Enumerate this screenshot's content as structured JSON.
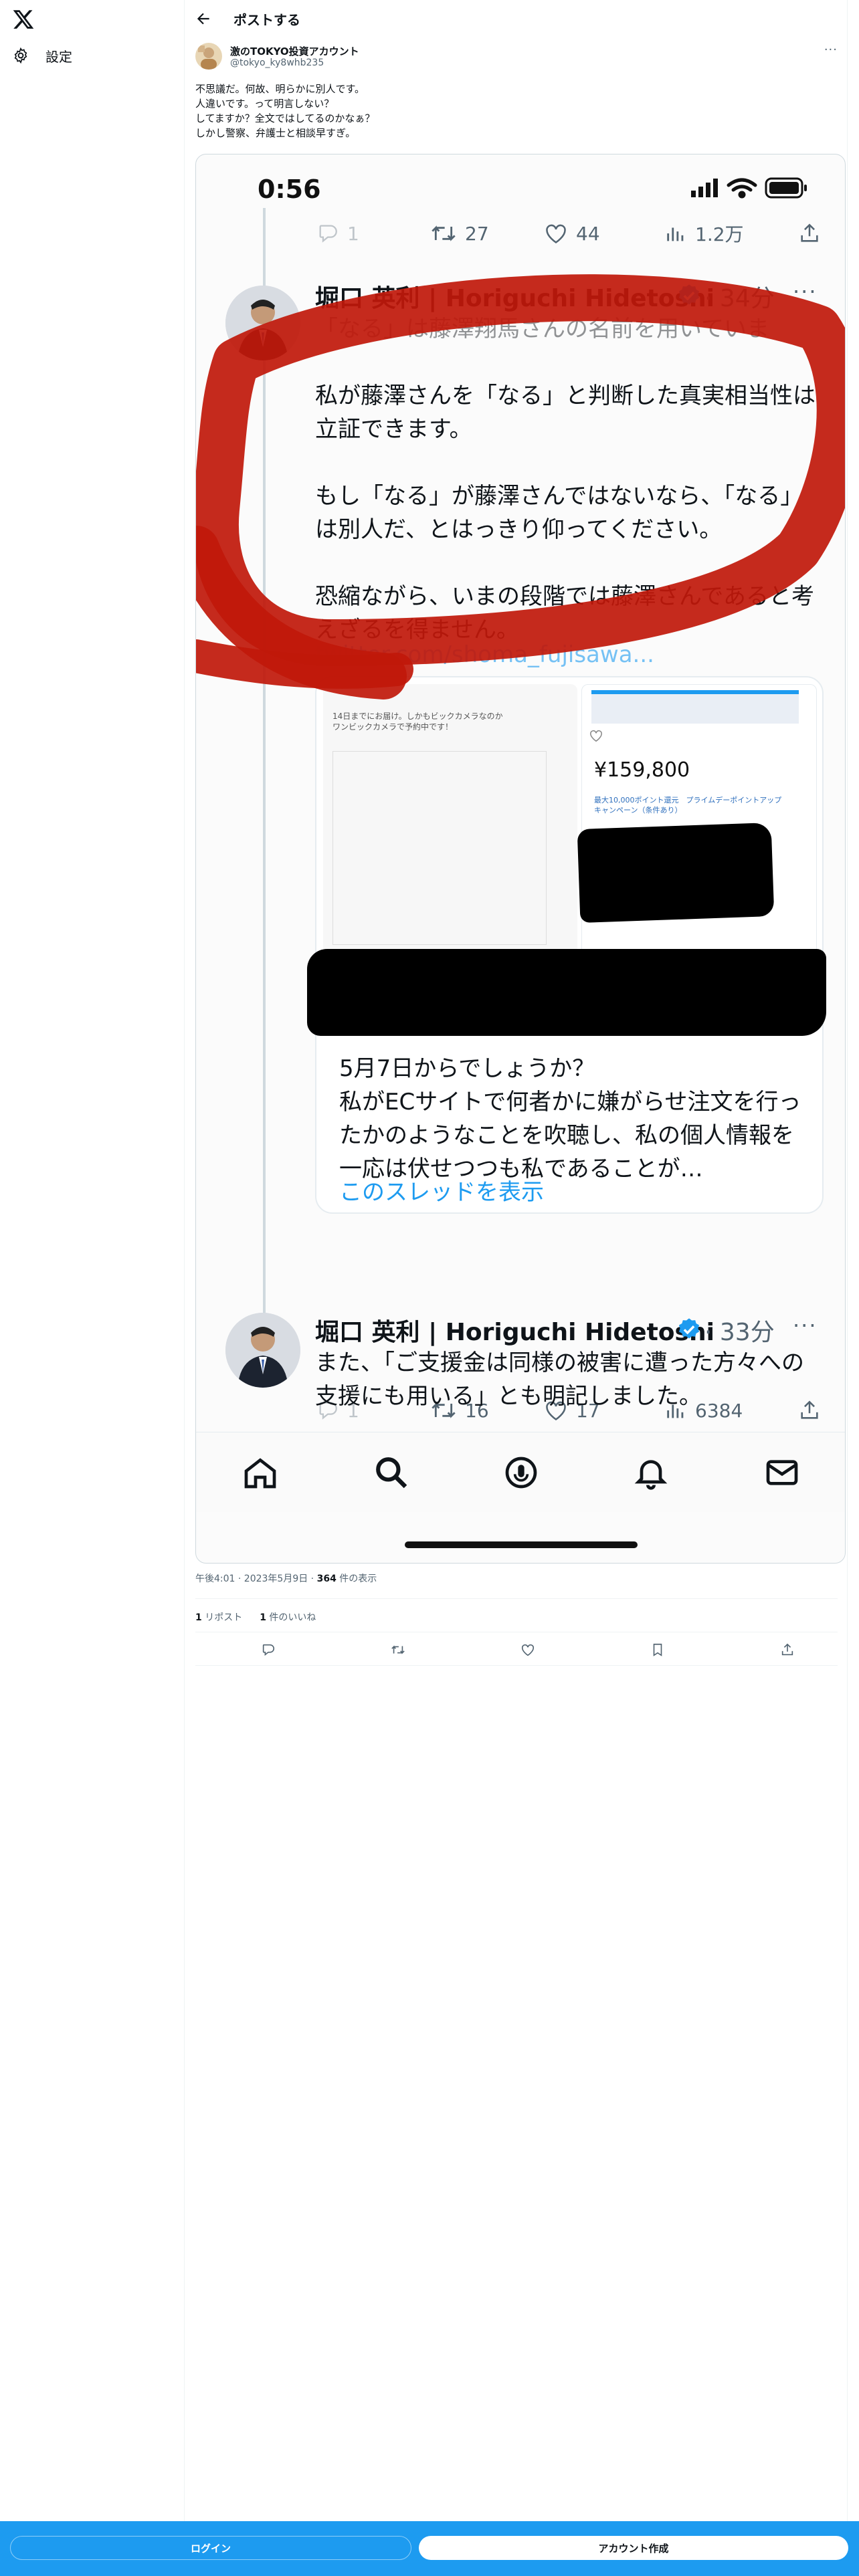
{
  "sidebar": {
    "logo_icon": "x-logo-icon",
    "settings_label": "設定"
  },
  "header": {
    "title": "ポストする"
  },
  "post": {
    "display_name": "激のTOKYO投資アカウント",
    "handle": "@tokyo_ky8whb235",
    "more": "···",
    "text": "不思議だ。何故、明らかに別人です。\n人違いです。って明言しない？\nしてますか？全文ではしてるのかなぁ？\nしかし警察、弁護士と相談早すぎ。",
    "meta_time": "午後4:01 · 2023年5月9日 · ",
    "meta_views": "364",
    "meta_views_label": " 件の表示",
    "reposts_count": "1",
    "reposts_label": " リポスト",
    "likes_count": "1",
    "likes_label": " 件のいいね"
  },
  "screenshot": {
    "status_time": "0:56",
    "top_actions": {
      "reply": "1",
      "retweets": "27",
      "likes": "44",
      "views": "1.2万"
    },
    "tweet1": {
      "name": "堀口 英利 | Horiguchi Hidetoshi",
      "time": "· 34分",
      "more": "···",
      "faded_line": "「なる」は藤澤翔馬さんの名前を用いていま",
      "body": "私が藤澤さんを「なる」と判断した真実相当性は立証できます。\n\nもし「なる」が藤澤さんではないなら、「なる」は別人だ、とはっきり仰ってください。\n\n恐縮ながら、いまの段階では藤澤さんであると考えざるを得ません。",
      "link": "twitter.com/shoma_fujisawa..."
    },
    "quote": {
      "left_text": "14日までにお届け。しかもビックカメラなのか\nワンビックカメラで予約中です！",
      "price": "¥159,800",
      "promo": "最大10,000ポイント還元　プライムデーポイントアップ\nキャンペーン（条件あり）",
      "text": "5月7日からでしょうか？\n私がECサイトで何者かに嫌がらせ注文を行ったかのようなことを吹聴し、私の個人情報を一応は伏せつつも私であることが…",
      "show_thread": "このスレッドを表示"
    },
    "mid_actions": {
      "reply": "1",
      "retweets": "16",
      "likes": "17",
      "views": "6384"
    },
    "tweet2": {
      "name": "堀口 英利 | Horiguchi Hidetoshi",
      "time": "· 33分",
      "more": "···",
      "body": "また、「ご支援金は同様の被害に遭った方々への支援にも用いる」とも明記しました。"
    }
  },
  "bottom": {
    "login_label": "ログイン",
    "signup_label": "アカウント作成"
  },
  "colors": {
    "accent": "#1d9bf0",
    "text": "#0f1419",
    "muted": "#536471",
    "scribble_red": "#c0180a"
  }
}
